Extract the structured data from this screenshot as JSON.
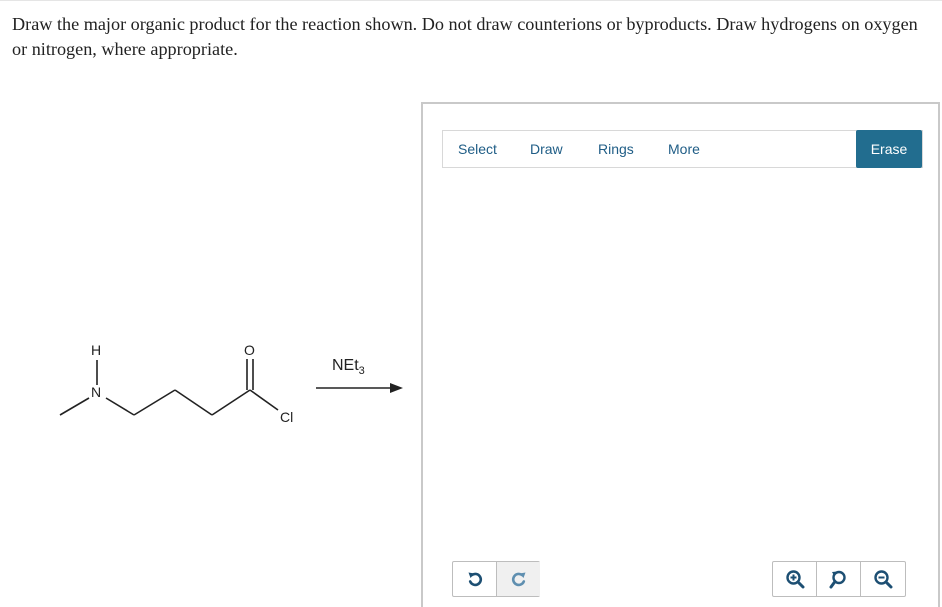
{
  "question": {
    "text": "Draw the major organic product for the reaction shown. Do not draw counterions or byproducts. Draw hydrogens on oxygen or nitrogen, where appropriate."
  },
  "reaction": {
    "atom_labels": {
      "hydrogen": "H",
      "nitrogen": "N",
      "oxygen": "O",
      "chlorine": "Cl"
    },
    "reagent": {
      "base": "NEt",
      "subscript": "3"
    }
  },
  "editor": {
    "toolbar": {
      "select_label": "Select",
      "draw_label": "Draw",
      "rings_label": "Rings",
      "more_label": "More",
      "erase_label": "Erase"
    },
    "history": {
      "undo_icon": "undo-icon",
      "redo_icon": "redo-icon"
    },
    "zoom": {
      "zoom_in_icon": "zoom-in-icon",
      "zoom_reset_icon": "zoom-reset-icon",
      "zoom_out_icon": "zoom-out-icon"
    },
    "colors": {
      "accent": "#226d8f",
      "link": "#1f5d86",
      "icon": "#1d4f73",
      "border": "#c9c9c9"
    }
  }
}
